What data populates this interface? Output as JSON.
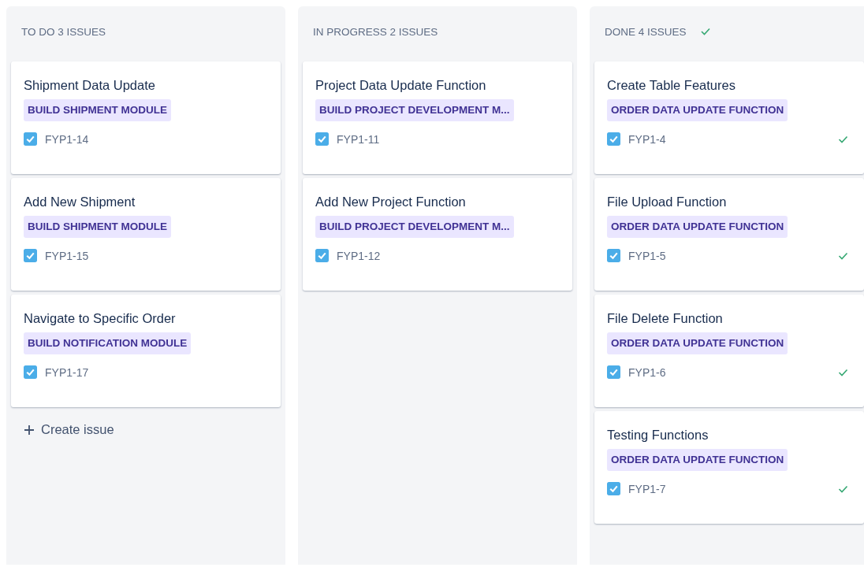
{
  "columns": [
    {
      "title": "TO DO 3 ISSUES",
      "done": false,
      "create_label": "Create issue",
      "issues": [
        {
          "title": "Shipment Data Update",
          "epic": "BUILD SHIPMENT MODULE",
          "key": "FYP1-14",
          "checked": true,
          "resolved": false
        },
        {
          "title": "Add New Shipment",
          "epic": "BUILD SHIPMENT MODULE",
          "key": "FYP1-15",
          "checked": true,
          "resolved": false
        },
        {
          "title": "Navigate to Specific Order",
          "epic": "BUILD NOTIFICATION MODULE",
          "key": "FYP1-17",
          "checked": true,
          "resolved": false
        }
      ]
    },
    {
      "title": "IN PROGRESS 2 ISSUES",
      "done": false,
      "issues": [
        {
          "title": "Project Data Update Function",
          "epic": "BUILD PROJECT DEVELOPMENT M...",
          "key": "FYP1-11",
          "checked": true,
          "resolved": false
        },
        {
          "title": "Add New Project Function",
          "epic": "BUILD PROJECT DEVELOPMENT M...",
          "key": "FYP1-12",
          "checked": true,
          "resolved": false
        }
      ]
    },
    {
      "title": "DONE 4 ISSUES",
      "done": true,
      "issues": [
        {
          "title": "Create Table Features",
          "epic": "ORDER DATA UPDATE FUNCTION",
          "key": "FYP1-4",
          "checked": true,
          "resolved": true
        },
        {
          "title": "File Upload Function",
          "epic": "ORDER DATA UPDATE FUNCTION",
          "key": "FYP1-5",
          "checked": true,
          "resolved": true
        },
        {
          "title": "File Delete Function",
          "epic": "ORDER DATA UPDATE FUNCTION",
          "key": "FYP1-6",
          "checked": true,
          "resolved": true
        },
        {
          "title": "Testing Functions",
          "epic": "ORDER DATA UPDATE FUNCTION",
          "key": "FYP1-7",
          "checked": true,
          "resolved": true
        }
      ]
    }
  ]
}
